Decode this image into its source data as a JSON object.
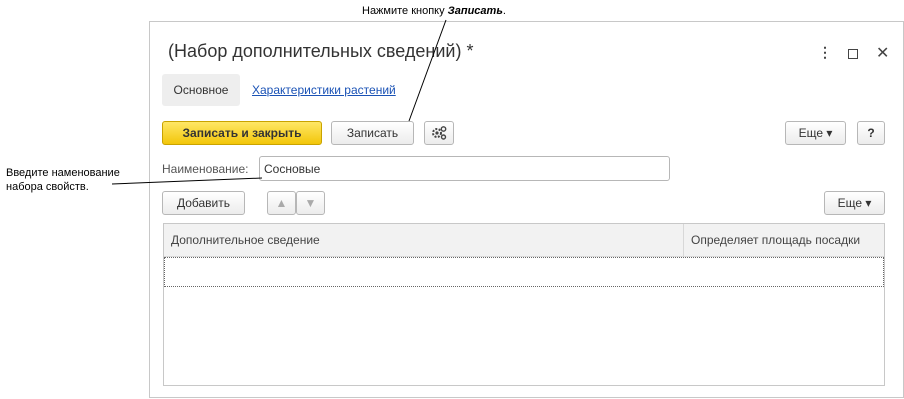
{
  "annotations": {
    "top_prefix": "Нажмите кнопку ",
    "top_emphasis": "Записать",
    "top_suffix": ".",
    "left": "Введите наменование набора свойств."
  },
  "window": {
    "title": "(Набор дополнительных сведений) *",
    "controls": {
      "more": "⋮",
      "close": "✕"
    }
  },
  "tabs": [
    {
      "label": "Основное"
    },
    {
      "label": "Характеристики растений"
    }
  ],
  "toolbar": {
    "save_close_label": "Записать и закрыть",
    "save_label": "Записать",
    "gear_icon": "gear-icon",
    "more_label": "Еще ▾",
    "help_label": "?"
  },
  "form": {
    "name_label": "Наименование:",
    "name_value": "Сосновые"
  },
  "table_toolbar": {
    "add_label": "Добавить",
    "up_icon": "▲",
    "down_icon": "▼",
    "more_label": "Еще ▾"
  },
  "table": {
    "columns": [
      "Дополнительное сведение",
      "Определяет площадь посадки"
    ],
    "rows": [
      [
        "",
        ""
      ]
    ]
  },
  "colors": {
    "primary_button": "#f2c60a",
    "link": "#1a52b5"
  }
}
